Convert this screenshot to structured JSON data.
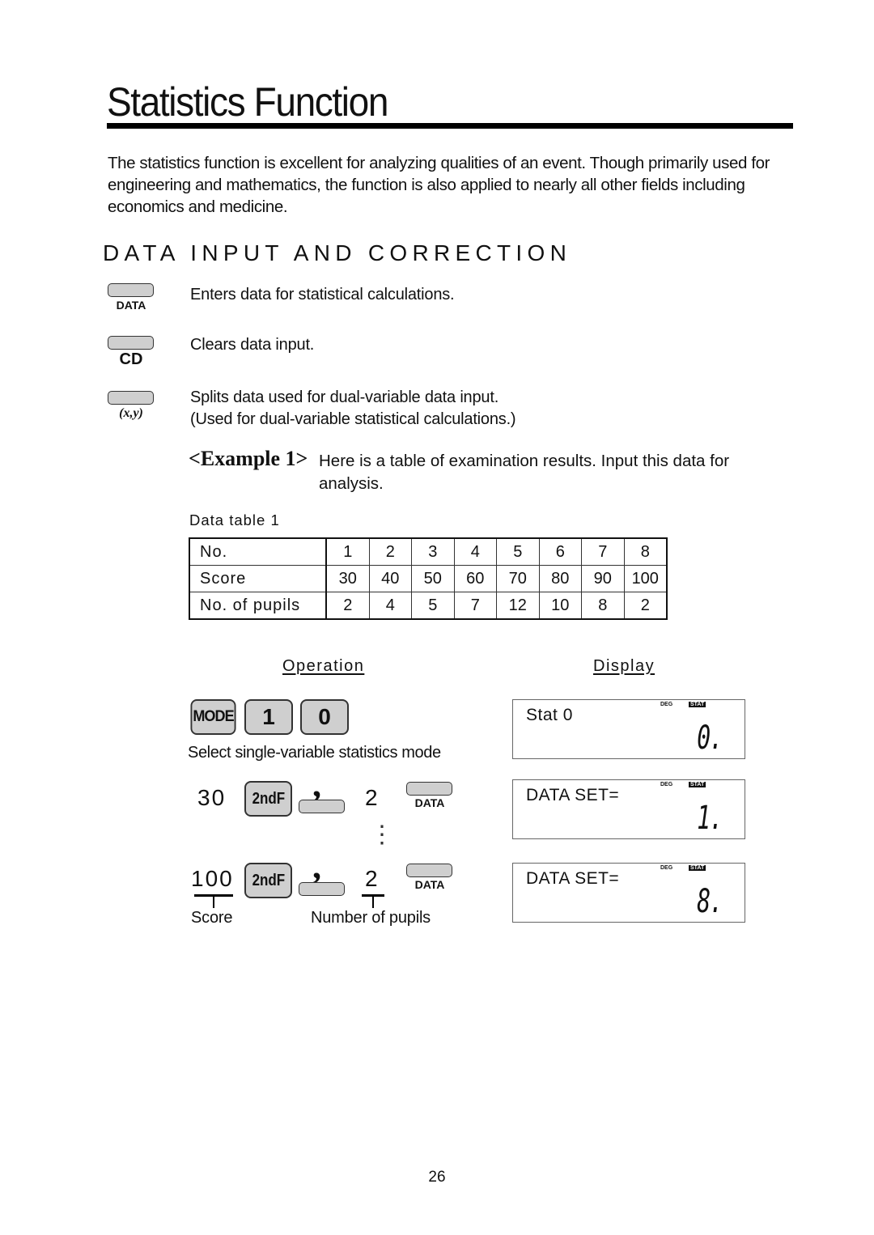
{
  "page": {
    "title": "Statistics Function",
    "intro": "The statistics function is excellent for analyzing qualities of an event. Though primarily used for engineering and mathematics, the function is also applied to nearly all other fields including economics and medicine.",
    "section_heading": "DATA INPUT AND CORRECTION",
    "page_number": "26"
  },
  "keys": [
    {
      "label": "DATA",
      "description": "Enters data for statistical calculations."
    },
    {
      "label": "CD",
      "description": "Clears data input."
    },
    {
      "label": "(x,y)",
      "description_line1": "Splits data used for dual-variable data input.",
      "description_line2": "(Used for dual-variable statistical calculations.)"
    }
  ],
  "example": {
    "tag": "<Example 1>",
    "text": "Here is a table of examination results. Input this data for analysis.",
    "table_caption": "Data table 1",
    "table": {
      "rows": [
        {
          "header": "No.",
          "values": [
            "1",
            "2",
            "3",
            "4",
            "5",
            "6",
            "7",
            "8"
          ]
        },
        {
          "header": "Score",
          "values": [
            "30",
            "40",
            "50",
            "60",
            "70",
            "80",
            "90",
            "100"
          ]
        },
        {
          "header": "No. of pupils",
          "values": [
            "2",
            "4",
            "5",
            "7",
            "12",
            "10",
            "8",
            "2"
          ]
        }
      ]
    }
  },
  "operation": {
    "heading": "Operation",
    "step1_keys": [
      "MODE",
      "1",
      "0"
    ],
    "step1_caption": "Select single-variable statistics mode",
    "step2": {
      "score": "30",
      "key_2ndf": "2ndF",
      "comma": ",",
      "pupils": "2",
      "data_key": "DATA"
    },
    "ellipsis": "⋮",
    "step3": {
      "score": "100",
      "key_2ndf": "2ndF",
      "comma": ",",
      "pupils": "2",
      "data_key": "DATA"
    },
    "score_label": "Score",
    "pupils_label": "Number of pupils"
  },
  "display": {
    "heading": "Display",
    "screens": [
      {
        "text": "Stat 0",
        "deg": "DEG",
        "stat": "STAT",
        "value": "0."
      },
      {
        "text": "DATA SET=",
        "deg": "DEG",
        "stat": "STAT",
        "value": "1."
      },
      {
        "text": "DATA SET=",
        "deg": "DEG",
        "stat": "STAT",
        "value": "8."
      }
    ]
  }
}
